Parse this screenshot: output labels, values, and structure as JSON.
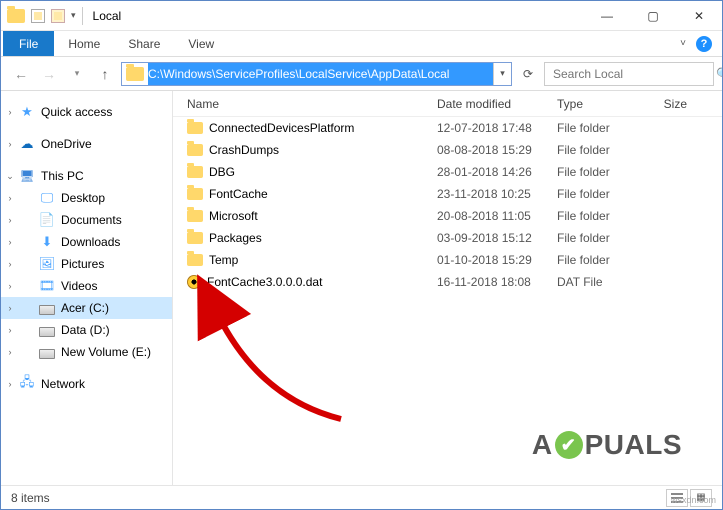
{
  "window": {
    "title": "Local"
  },
  "menu": {
    "file": "File",
    "home": "Home",
    "share": "Share",
    "view": "View"
  },
  "nav": {
    "path": "C:\\Windows\\ServiceProfiles\\LocalService\\AppData\\Local",
    "search_placeholder": "Search Local"
  },
  "tree": {
    "quick": "Quick access",
    "onedrive": "OneDrive",
    "thispc": "This PC",
    "desktop": "Desktop",
    "documents": "Documents",
    "downloads": "Downloads",
    "pictures": "Pictures",
    "videos": "Videos",
    "acer": "Acer (C:)",
    "data": "Data (D:)",
    "newvol": "New Volume (E:)",
    "network": "Network"
  },
  "cols": {
    "name": "Name",
    "date": "Date modified",
    "type": "Type",
    "size": "Size"
  },
  "rows": [
    {
      "name": "ConnectedDevicesPlatform",
      "date": "12-07-2018 17:48",
      "type": "File folder",
      "icon": "folder"
    },
    {
      "name": "CrashDumps",
      "date": "08-08-2018 15:29",
      "type": "File folder",
      "icon": "folder"
    },
    {
      "name": "DBG",
      "date": "28-01-2018 14:26",
      "type": "File folder",
      "icon": "folder"
    },
    {
      "name": "FontCache",
      "date": "23-11-2018 10:25",
      "type": "File folder",
      "icon": "folder"
    },
    {
      "name": "Microsoft",
      "date": "20-08-2018 11:05",
      "type": "File folder",
      "icon": "folder"
    },
    {
      "name": "Packages",
      "date": "03-09-2018 15:12",
      "type": "File folder",
      "icon": "folder"
    },
    {
      "name": "Temp",
      "date": "01-10-2018 15:29",
      "type": "File folder",
      "icon": "folder"
    },
    {
      "name": "FontCache3.0.0.0.dat",
      "date": "16-11-2018 18:08",
      "type": "DAT File",
      "icon": "dat"
    }
  ],
  "status": {
    "count": "8 items"
  },
  "watermark": {
    "pre": "A",
    "post": "PUALS"
  },
  "corner": "wsxdn.com"
}
